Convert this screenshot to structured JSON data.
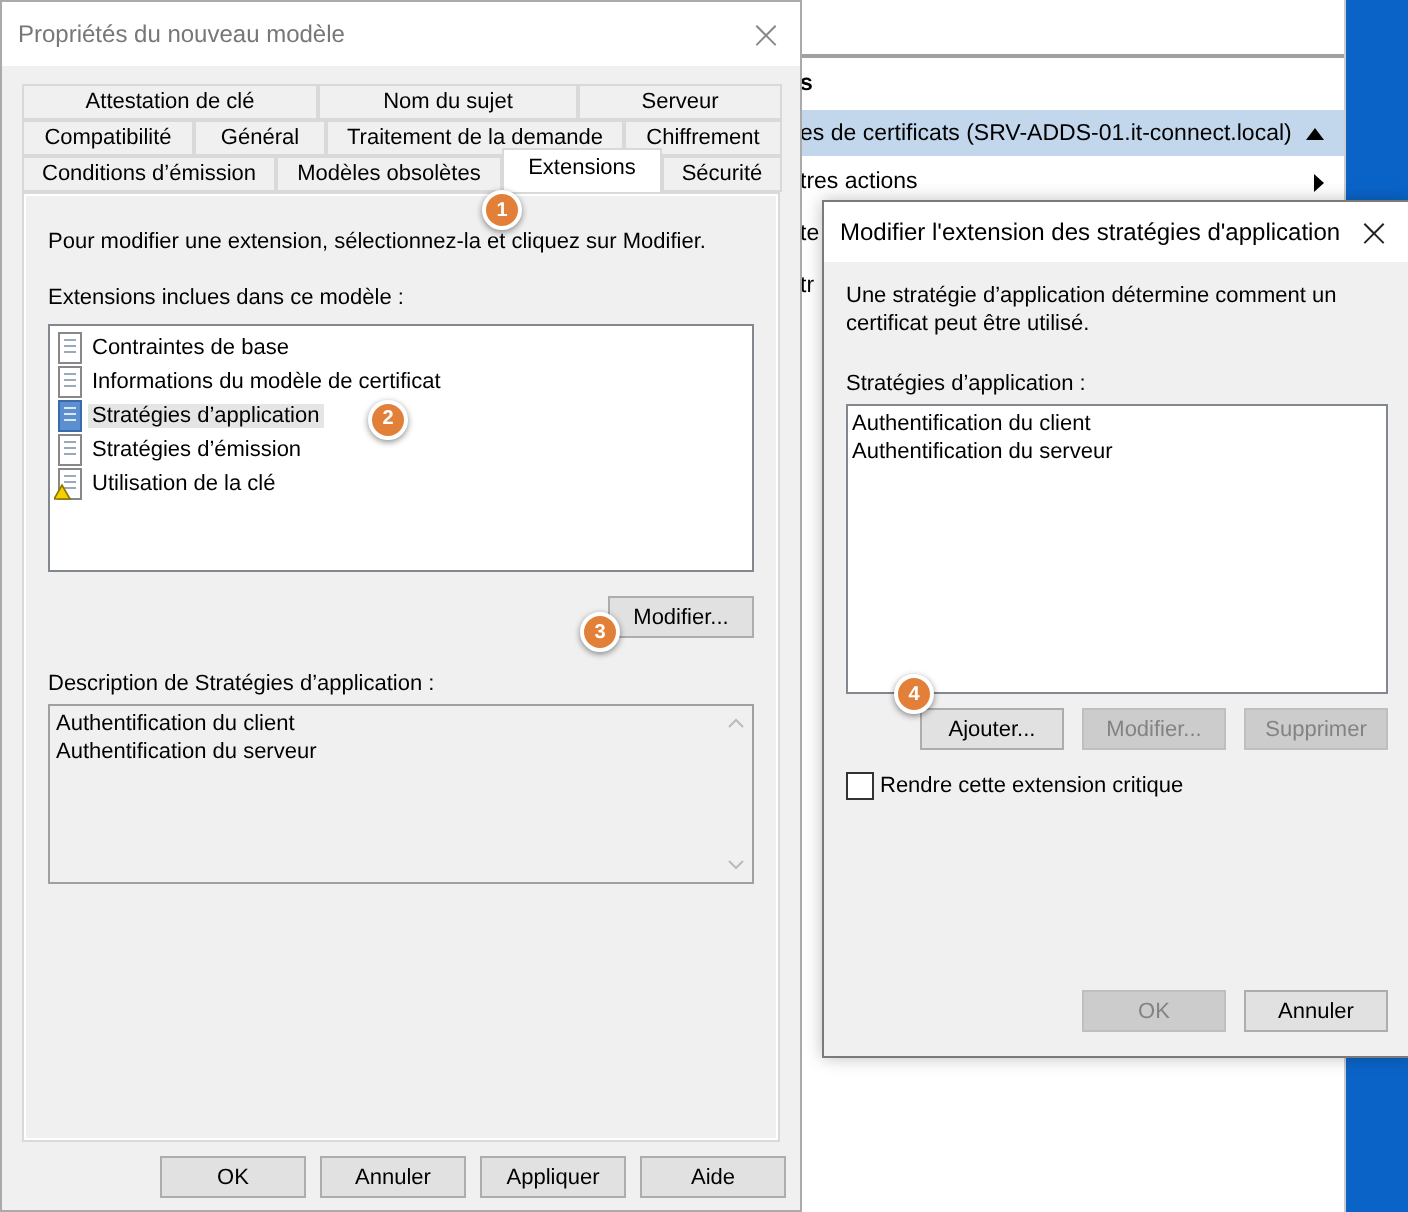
{
  "background_window": {
    "rows": [
      {
        "text": "s",
        "kind": "header",
        "selected": false
      },
      {
        "text": "es de certificats (SRV-ADDS-01.it-connect.local)",
        "kind": "collapsible",
        "selected": true
      },
      {
        "text": "tres actions",
        "kind": "submenu",
        "selected": false
      },
      {
        "text": "te",
        "kind": "plain",
        "selected": false
      },
      {
        "text": "tr",
        "kind": "plain",
        "selected": false
      }
    ]
  },
  "properties_dialog": {
    "title": "Propriétés du nouveau modèle",
    "close": "×",
    "tab_rows": [
      [
        {
          "label": "Attestation de clé",
          "selected": false
        },
        {
          "label": "Nom du sujet",
          "selected": false
        },
        {
          "label": "Serveur",
          "selected": false
        }
      ],
      [
        {
          "label": "Compatibilité",
          "selected": false
        },
        {
          "label": "Général",
          "selected": false
        },
        {
          "label": "Traitement de la demande",
          "selected": false
        },
        {
          "label": "Chiffrement",
          "selected": false
        }
      ],
      [
        {
          "label": "Conditions d’émission",
          "selected": false
        },
        {
          "label": "Modèles obsolètes",
          "selected": false
        },
        {
          "label": "Extensions",
          "selected": true,
          "callout": "1"
        },
        {
          "label": "Sécurité",
          "selected": false
        }
      ]
    ],
    "instruction": "Pour modifier une extension, sélectionnez-la et cliquez sur Modifier.",
    "extensions_label": "Extensions inclues dans ce modèle :",
    "extensions": [
      {
        "label": "Contraintes de base",
        "kind": "document",
        "selected": false
      },
      {
        "label": "Informations du modèle de certificat",
        "kind": "document",
        "selected": false
      },
      {
        "label": "Stratégies d’application",
        "kind": "document",
        "selected": true,
        "callout": "2"
      },
      {
        "label": "Stratégies d’émission",
        "kind": "document",
        "selected": false
      },
      {
        "label": "Utilisation de la clé",
        "kind": "warning",
        "selected": false
      }
    ],
    "modify_button": {
      "label": "Modifier...",
      "callout": "3"
    },
    "description_label": "Description de Stratégies d’application :",
    "description_lines": [
      "Authentification du client",
      "Authentification du serveur"
    ],
    "buttons": [
      "OK",
      "Annuler",
      "Appliquer",
      "Aide"
    ]
  },
  "edit_dialog": {
    "title": "Modifier l'extension des stratégies d'application",
    "close": "×",
    "description": "Une stratégie d’application détermine comment un certificat peut être utilisé.",
    "list_label": "Stratégies d’application :",
    "policies": [
      "Authentification du client",
      "Authentification du serveur"
    ],
    "buttons": [
      {
        "label": "Ajouter...",
        "disabled": false,
        "callout": "4"
      },
      {
        "label": "Modifier...",
        "disabled": true
      },
      {
        "label": "Supprimer",
        "disabled": true
      }
    ],
    "critical_checkbox": {
      "label": "Rendre cette extension critique",
      "checked": false
    },
    "footer_buttons": [
      {
        "label": "OK",
        "disabled": true
      },
      {
        "label": "Annuler",
        "disabled": false
      }
    ]
  }
}
